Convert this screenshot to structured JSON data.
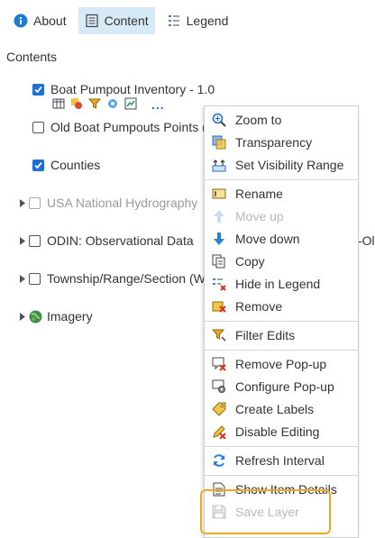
{
  "tabs": [
    {
      "label": "About"
    },
    {
      "label": "Content"
    },
    {
      "label": "Legend"
    }
  ],
  "contents_title": "Contents",
  "layers": [
    {
      "label": "Boat Pumpout Inventory - 1.0",
      "checked": true
    },
    {
      "label": "Old Boat Pumpouts Points (",
      "checked": false
    },
    {
      "label": "Counties",
      "checked": true
    },
    {
      "label": "USA National Hydrography",
      "checked": false
    },
    {
      "label": "ODIN: Observational Data",
      "checked": false
    },
    {
      "label": "Township/Range/Section (W",
      "checked": false
    },
    {
      "label": "Imagery"
    }
  ],
  "odin_overflow_text": "-Ol",
  "more_button": "...",
  "menu": {
    "items": [
      {
        "label": "Zoom to",
        "icon": "zoom-to-icon"
      },
      {
        "label": "Transparency",
        "icon": "transparency-icon"
      },
      {
        "label": "Set Visibility Range",
        "icon": "visibility-range-icon"
      },
      {
        "label": "Rename",
        "icon": "rename-icon"
      },
      {
        "label": "Move up",
        "icon": "arrow-up-icon",
        "disabled": true
      },
      {
        "label": "Move down",
        "icon": "arrow-down-icon"
      },
      {
        "label": "Copy",
        "icon": "copy-icon"
      },
      {
        "label": "Hide in Legend",
        "icon": "hide-in-legend-icon"
      },
      {
        "label": "Remove",
        "icon": "remove-icon"
      },
      {
        "label": "Filter Edits",
        "icon": "filter-icon"
      },
      {
        "label": "Remove Pop-up",
        "icon": "remove-popup-icon"
      },
      {
        "label": "Configure Pop-up",
        "icon": "configure-popup-icon"
      },
      {
        "label": "Create Labels",
        "icon": "labels-icon"
      },
      {
        "label": "Disable Editing",
        "icon": "disable-editing-icon"
      },
      {
        "label": "Refresh Interval",
        "icon": "refresh-icon"
      },
      {
        "label": "Show Item Details",
        "icon": "item-details-icon"
      },
      {
        "label": "Save Layer",
        "icon": "save-icon",
        "disabled": true
      }
    ]
  },
  "colors": {
    "accent": "#1d6fd1",
    "active_tab_bg": "#d7eaf7",
    "highlight_border": "#f0a81e"
  }
}
